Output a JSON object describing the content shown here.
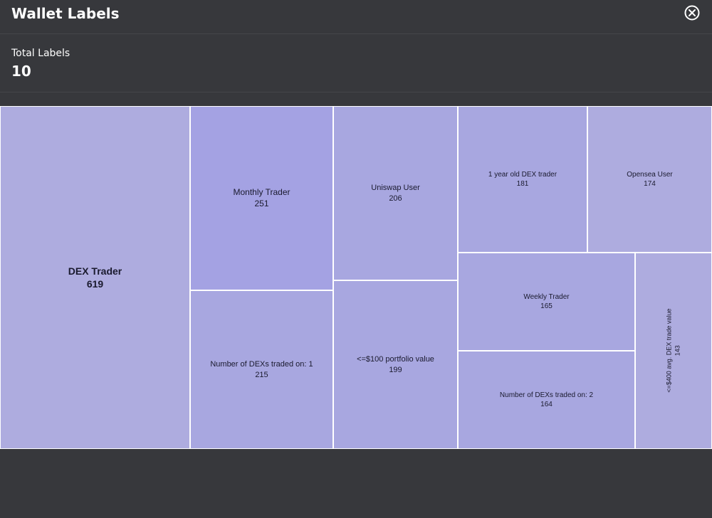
{
  "header": {
    "title": "Wallet Labels",
    "close_icon": "close-circle-icon"
  },
  "summary": {
    "label": "Total Labels",
    "value": "10"
  },
  "colors": {
    "background": "#37383c",
    "cell_light": "#aeacdf",
    "cell_mid": "#a8a7e0",
    "cell_dark": "#a4a2e3"
  },
  "chart_data": {
    "type": "treemap",
    "items": [
      {
        "label": "DEX Trader",
        "value": 619
      },
      {
        "label": "Monthly Trader",
        "value": 251
      },
      {
        "label": "Number of DEXs traded on: 1",
        "value": 215
      },
      {
        "label": "Uniswap User",
        "value": 206
      },
      {
        "label": "<=$100 portfolio value",
        "value": 199
      },
      {
        "label": "1 year old DEX trader",
        "value": 181
      },
      {
        "label": "Opensea User",
        "value": 174
      },
      {
        "label": "Weekly Trader",
        "value": 165
      },
      {
        "label": "Number of DEXs traded on: 2",
        "value": 164
      },
      {
        "label": "<=$400 avg. DEX trade value",
        "value": 143
      }
    ]
  }
}
